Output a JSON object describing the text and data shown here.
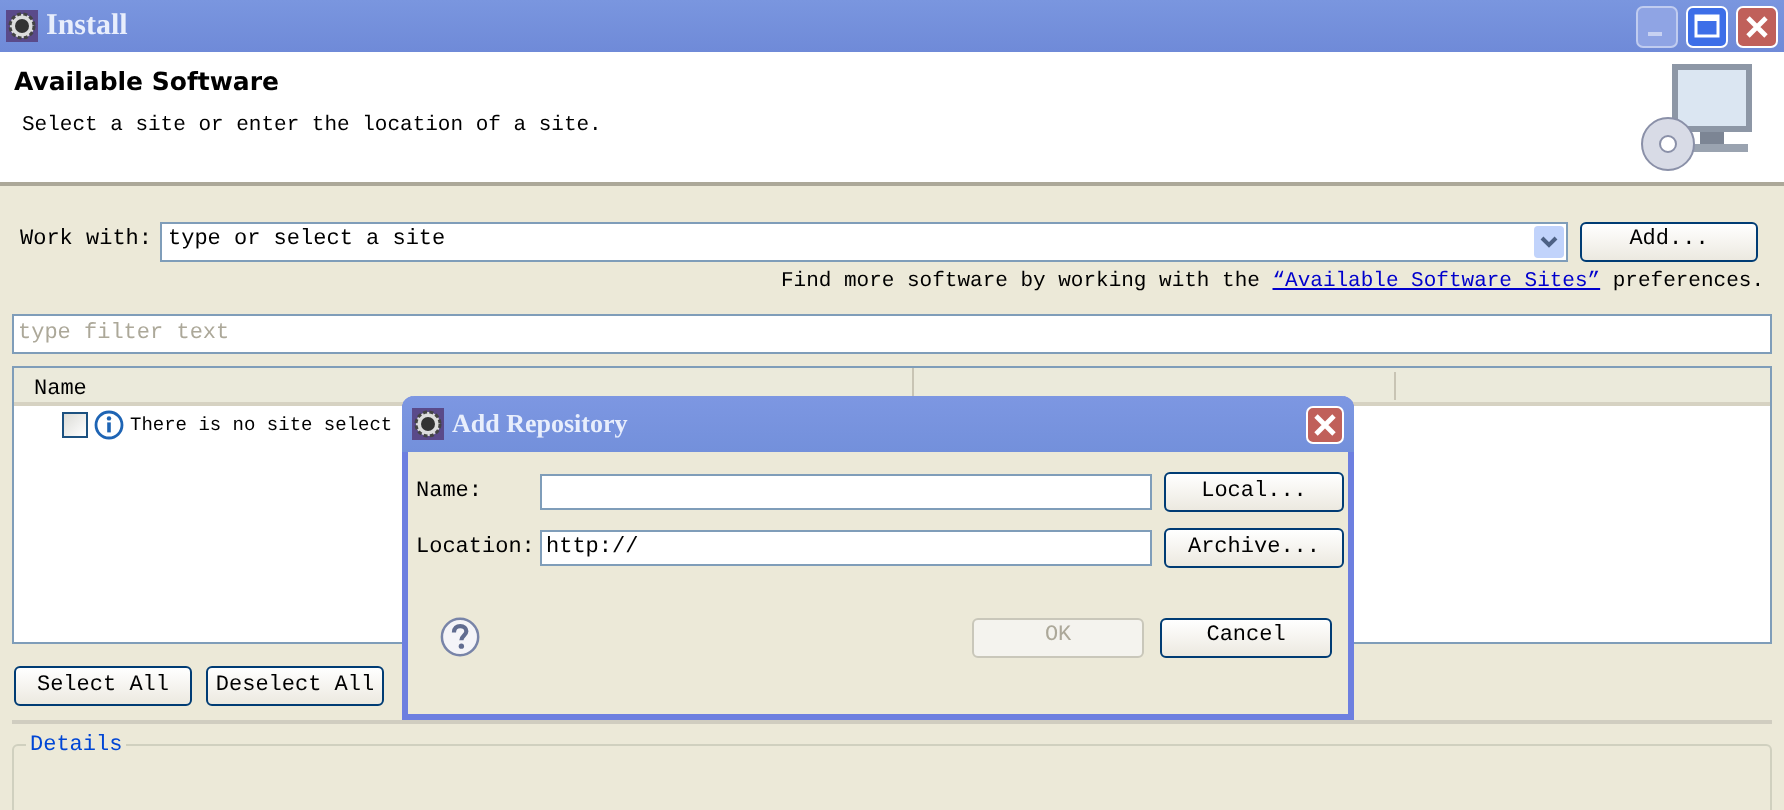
{
  "window": {
    "title": "Install"
  },
  "header": {
    "title": "Available Software",
    "subtitle": "Select a site or enter the location of a site."
  },
  "work_with": {
    "label": "Work with:",
    "value": "type or select a site",
    "button": "Add..."
  },
  "hint": {
    "before": "Find more software by working with the ",
    "link": "“Available Software Sites”",
    "after": " preferences."
  },
  "filter": {
    "placeholder": "type filter text"
  },
  "table": {
    "columns": [
      "Name"
    ],
    "rows": [
      {
        "checked": false,
        "text": "There is no site select"
      }
    ]
  },
  "buttons": [
    "Select All",
    "Deselect All"
  ],
  "details": {
    "title": "Details"
  },
  "dialog": {
    "title": "Add Repository",
    "fields": [
      {
        "label": "Name:",
        "button": "Local..."
      },
      {
        "label": "Location:",
        "value": "http://",
        "button": "Archive..."
      }
    ],
    "buttons": [
      {
        "label": "OK",
        "disabled": true
      },
      {
        "label": "Cancel",
        "disabled": false
      }
    ]
  }
}
